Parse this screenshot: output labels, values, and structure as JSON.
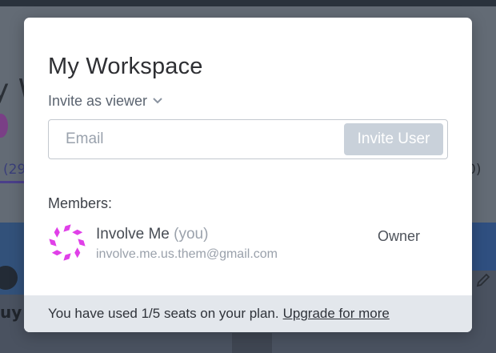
{
  "background": {
    "heading_fragment": "y W",
    "left_count_fragment": "(29",
    "right_count_fragment": "0)",
    "card_text_fragment": "uy"
  },
  "modal": {
    "title": "My Workspace",
    "role_dropdown": {
      "label": "Invite as viewer",
      "icon": "chevron-down-icon"
    },
    "invite": {
      "email_placeholder": "Email",
      "email_value": "",
      "button_label": "Invite User"
    },
    "members_label": "Members:",
    "members": [
      {
        "name": "Involve Me",
        "you_tag": "(you)",
        "email": "involve.me.us.them@gmail.com",
        "role": "Owner",
        "avatar_color": "#e040e8"
      }
    ],
    "footer": {
      "usage_text": "You have used 1/5 seats on your plan.",
      "upgrade_link": "Upgrade for more"
    }
  },
  "colors": {
    "overlay": "#5f6670",
    "button_disabled": "#c9d1da",
    "footer_bg": "#e3e7ec",
    "avatar_accent": "#e040e8"
  }
}
